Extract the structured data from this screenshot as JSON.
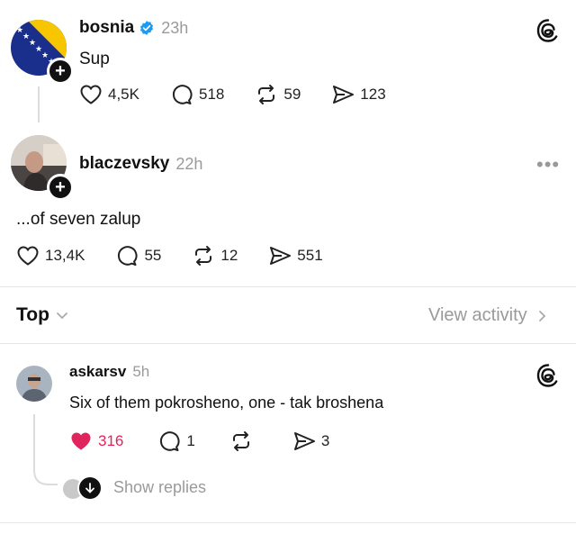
{
  "post1": {
    "username": "bosnia",
    "time": "23h",
    "text": "Sup",
    "likes": "4,5K",
    "comments": "518",
    "reposts": "59",
    "shares": "123",
    "verified": true,
    "flag_colors": {
      "blue": "#1a2e8c",
      "yellow": "#f7c600"
    }
  },
  "post2": {
    "username": "blaczevsky",
    "time": "22h",
    "text": "...of seven zalup",
    "likes": "13,4K",
    "comments": "55",
    "reposts": "12",
    "shares": "551"
  },
  "sort": {
    "label": "Top",
    "view_activity": "View activity"
  },
  "reply": {
    "username": "askarsv",
    "time": "5h",
    "text": "Six of them pokrosheno, one - tak broshena",
    "likes": "316",
    "comments": "1",
    "shares": "3",
    "show_replies": "Show replies",
    "like_color": "#e0245e"
  },
  "icons": [
    "threads-logo-icon",
    "verified-badge-icon",
    "heart-icon",
    "comment-icon",
    "repost-icon",
    "share-icon",
    "more-icon",
    "chevron-down-icon",
    "chevron-right-icon"
  ]
}
